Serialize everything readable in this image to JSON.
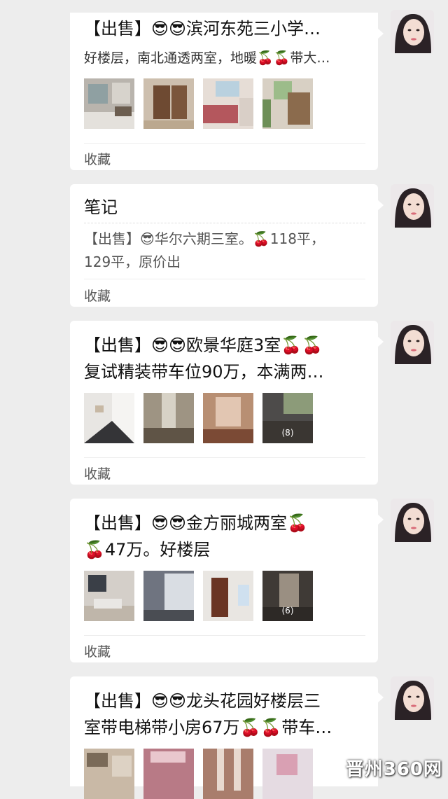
{
  "posts": [
    {
      "title_lines": [
        "【出售】😎😎滨河东苑三小学…"
      ],
      "subtitle": "好楼层，南北通透两室，地暖🍒🍒带大…",
      "photo_count": "",
      "collect_label": "收藏"
    },
    {
      "note_header": "笔记",
      "note_lines": [
        "【出售】😎华尔六期三室。🍒118平，",
        "129平，原价出"
      ],
      "collect_label": "收藏"
    },
    {
      "title_lines": [
        "【出售】😎😎欧景华庭3室🍒🍒",
        "复试精装带车位90万，本满两…"
      ],
      "photo_count": "(8)",
      "collect_label": "收藏"
    },
    {
      "title_lines": [
        "【出售】😎😎金方丽城两室🍒",
        "🍒47万。好楼层"
      ],
      "photo_count": "(6)",
      "collect_label": "收藏"
    },
    {
      "title_lines": [
        "【出售】😎😎龙头花园好楼层三",
        "室带电梯带小房67万🍒🍒带车…"
      ],
      "photo_count": ""
    }
  ],
  "watermark": "晋州360网",
  "colors": {
    "background": "#ededed",
    "card": "#ffffff",
    "text": "#111111",
    "muted": "#555555"
  }
}
